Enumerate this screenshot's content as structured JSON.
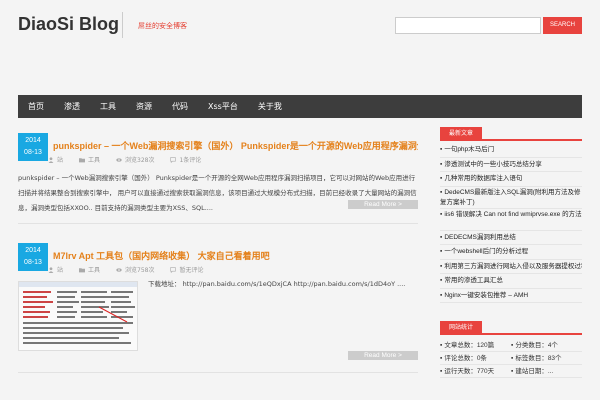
{
  "header": {
    "logo": "DiaoSi Blog",
    "tagline": "屌丝的安全博客",
    "search_placeholder": "",
    "search_button": "SEARCH"
  },
  "nav": [
    "首页",
    "渗透",
    "工具",
    "资源",
    "代码",
    "Xss平台",
    "关于我"
  ],
  "posts": [
    {
      "date_year": "2014",
      "date_day": "08-13",
      "title": "punkspider – 一个Web漏洞搜索引擎（国外） Punkspider是一个开源的Web应用程序漏洞全网扫描项目，已被整合进入搜索引擎",
      "author": "站",
      "category": "工具",
      "views": "浏览328次",
      "comments": "1条评论",
      "excerpt": "punkspider – 一个Web漏洞搜索引擎（国外） Punkspider是一个开源的全网Web应用程序漏洞扫描项目，它可以对网站的Web应用进行扫描并将结果整合到搜索引擎中， 用户可以直接通过搜索获取漏洞信息，该项目通过大规模分布式扫描，目前已经收录了大量网站的漏洞信息，漏洞类型包括XXOO.. 目前支持的漏洞类型主要为XSS、SQL....",
      "readmore": "Read More >"
    },
    {
      "date_year": "2014",
      "date_day": "08-13",
      "title": "M7lrv Apt 工具包（国内网络收集） 大家自己看着用吧",
      "author": "站",
      "category": "工具",
      "views": "浏览758次",
      "comments": "暂无评论",
      "excerpt": "下载地址： http://pan.baidu.com/s/1eQDxjCA http://pan.baidu.com/s/1dD4oY ....",
      "readmore": "Read More >"
    }
  ],
  "sidebar": {
    "recent_title": "最新文章",
    "recent": [
      "一句php木马后门",
      "渗透测试中的一些小技巧总结分享",
      "几种常用的数据库注入语句",
      "DedeCMS最新版注入SQL漏洞(附利用方法及修复方案补丁)",
      "iis6 错误解决 Can not find wmiprvse.exe 的方法",
      "DEDECMS漏洞利用总结",
      "一个webshell后门的分析过程",
      "利用第三方漏洞进行网站入侵以及服务器提权过程分享",
      "常用的渗透工具汇总",
      "Nginx一键安装包推荐 – AMH"
    ],
    "stats_title": "网站统计",
    "stats": [
      "文章总数：120篇",
      "分类数目：4个",
      "评论总数：0条",
      "标签数目：83个",
      "运行天数：770天",
      "建站日期：..."
    ]
  }
}
